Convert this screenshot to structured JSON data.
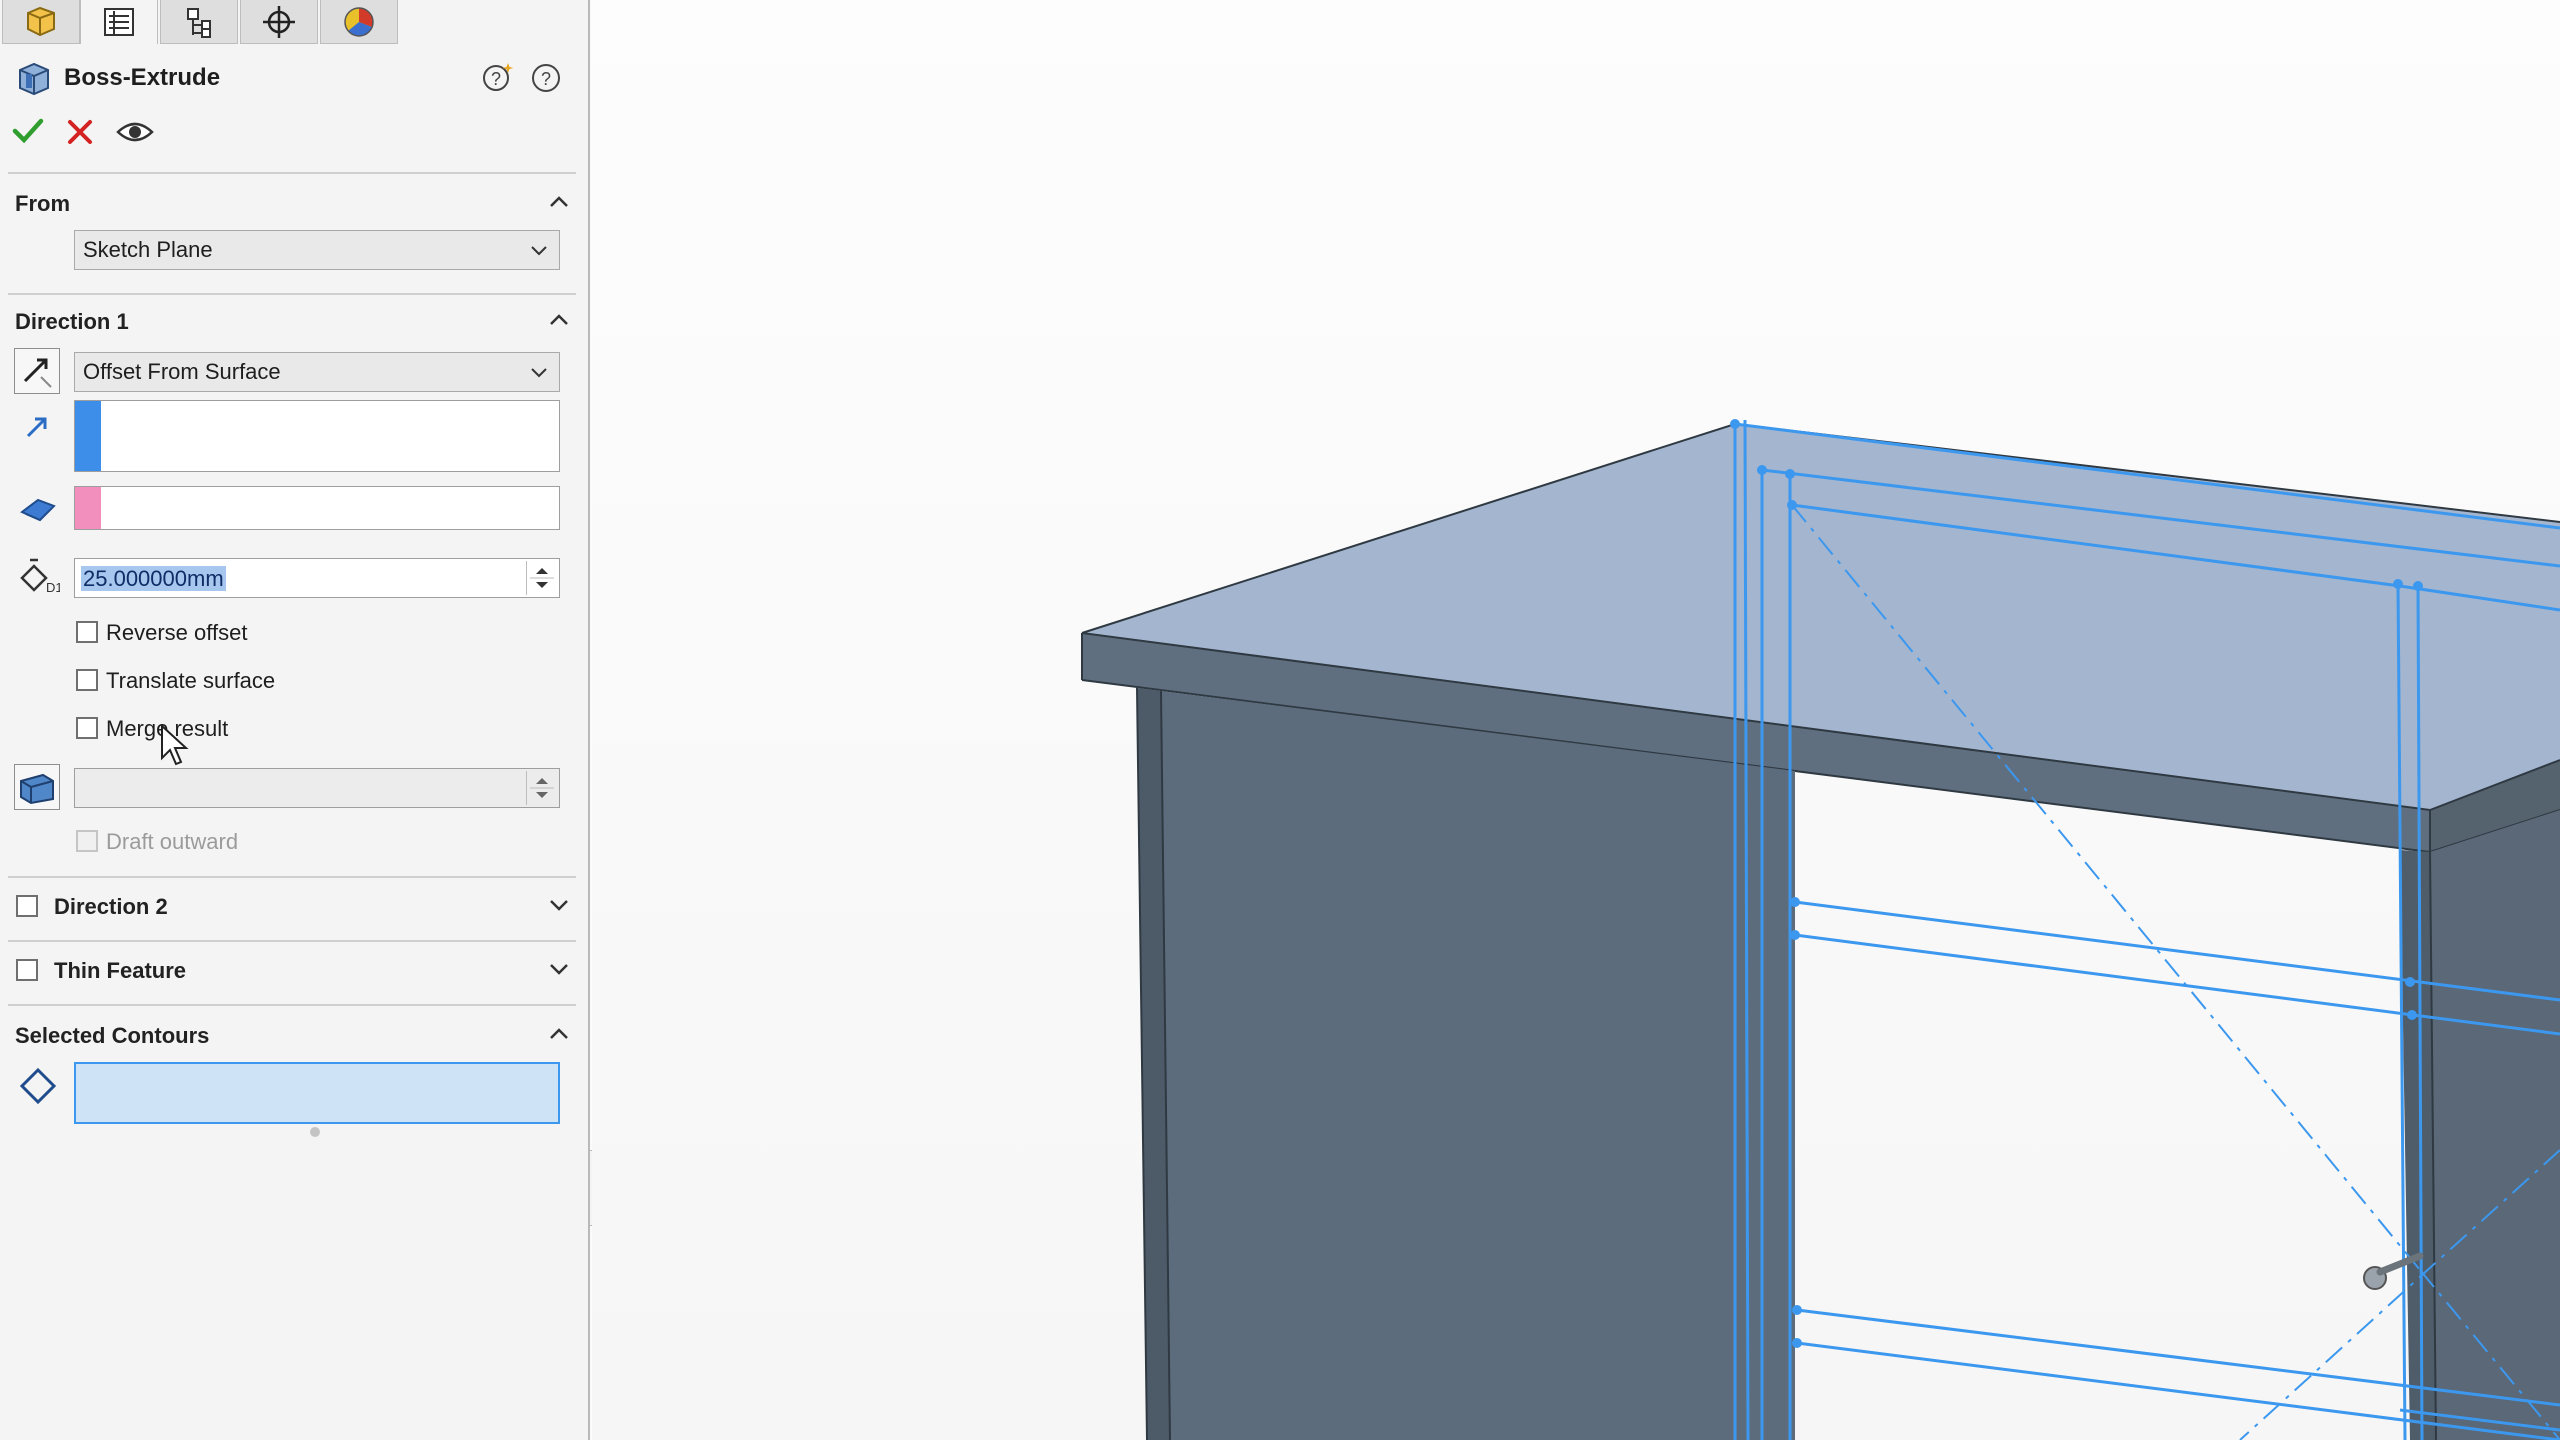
{
  "feature": {
    "title": "Boss-Extrude",
    "icon": "boss-extrude-icon"
  },
  "tabs": [
    {
      "name": "featuremanager-tab-icon"
    },
    {
      "name": "propertymanager-tab-icon"
    },
    {
      "name": "configurationmanager-tab-icon"
    },
    {
      "name": "dimxpertmanager-tab-icon"
    },
    {
      "name": "displaymanager-tab-icon"
    }
  ],
  "from_section": {
    "header": "From",
    "value": "Sketch Plane"
  },
  "direction1": {
    "header": "Direction 1",
    "end_condition": "Offset From Surface",
    "face_field_value": "",
    "direction_field_value": "",
    "offset_distance": "25.000000mm",
    "reverse_offset_label": "Reverse offset",
    "translate_surface_label": "Translate surface",
    "merge_result_label": "Merge result",
    "draft_value": "",
    "draft_outward_label": "Draft outward",
    "swatch_blue": "#3d8ee8",
    "swatch_pink": "#f28fbd"
  },
  "direction2": {
    "header": "Direction 2"
  },
  "thin_feature": {
    "header": "Thin Feature"
  },
  "selected_contours": {
    "header": "Selected Contours",
    "value": ""
  },
  "colors": {
    "accept": "#2f9e2f",
    "cancel": "#d42222",
    "sketch_blue": "#3c98ef",
    "selection_fill": "#cfe3f7",
    "model_face": "#5b6b7d",
    "model_top": "#9fb4d0"
  }
}
